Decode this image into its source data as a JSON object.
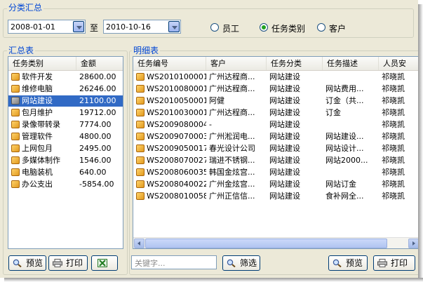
{
  "summary_group": {
    "title": "分类汇总",
    "date_from": "2008-01-01",
    "date_to_label": "至",
    "date_to": "2010-10-16",
    "radios": [
      {
        "label": "员工",
        "selected": false
      },
      {
        "label": "任务类别",
        "selected": true
      },
      {
        "label": "客户",
        "selected": false
      }
    ]
  },
  "summary_table": {
    "title": "汇总表",
    "columns": [
      "任务类别",
      "金额"
    ],
    "rows": [
      {
        "category": "软件开发",
        "amount": "28600.00",
        "selected": false
      },
      {
        "category": "维修电脑",
        "amount": "26246.00",
        "selected": false
      },
      {
        "category": "网站建设",
        "amount": "21100.00",
        "selected": true
      },
      {
        "category": "包月维护",
        "amount": "19712.00",
        "selected": false
      },
      {
        "category": "录像带转录",
        "amount": "7774.00",
        "selected": false
      },
      {
        "category": "管理软件",
        "amount": "4800.00",
        "selected": false
      },
      {
        "category": "上网包月",
        "amount": "2495.00",
        "selected": false
      },
      {
        "category": "多媒体制作",
        "amount": "1546.00",
        "selected": false
      },
      {
        "category": "电脑装机",
        "amount": "640.00",
        "selected": false
      },
      {
        "category": "办公支出",
        "amount": "-5854.00",
        "selected": false
      }
    ],
    "buttons": {
      "preview": "预览",
      "print": "打印"
    }
  },
  "detail_table": {
    "title": "明细表",
    "columns": [
      "任务编号",
      "客户",
      "任务分类",
      "任务描述",
      "人员安"
    ],
    "rows": [
      {
        "id": "WS2010100001",
        "customer": "广州达程商...",
        "category": "网站建设",
        "desc": "",
        "staff": "祁晓凯"
      },
      {
        "id": "WS2010080001",
        "customer": "广州达程商...",
        "category": "网站建设",
        "desc": "网站费用...",
        "staff": "祁晓凯"
      },
      {
        "id": "WS2010050001",
        "customer": "阿健",
        "category": "网站建设",
        "desc": "订金（共...",
        "staff": "祁晓凯"
      },
      {
        "id": "WS2010030001",
        "customer": "广州达程商...",
        "category": "网站建设",
        "desc": "订金",
        "staff": "祁晓凯"
      },
      {
        "id": "WS2009080004",
        "customer": "-",
        "category": "网站建设",
        "desc": "",
        "staff": "祁晓凯"
      },
      {
        "id": "WS2009070003",
        "customer": "广州淞润电...",
        "category": "网站建设",
        "desc": "网站建设...",
        "staff": "祁晓凯"
      },
      {
        "id": "WS2009050017",
        "customer": "春光设计公司",
        "category": "网站建设",
        "desc": "网站设计...",
        "staff": "祁晓凯"
      },
      {
        "id": "WS2008070027",
        "customer": "瑞进不锈钢...",
        "category": "网站建设",
        "desc": "网站2000...",
        "staff": "祁晓凯"
      },
      {
        "id": "WS2008060035",
        "customer": "韩国金炫宫...",
        "category": "网站建设",
        "desc": "",
        "staff": "祁晓凯"
      },
      {
        "id": "WS2008040022",
        "customer": "广州金炫宫...",
        "category": "网站建设",
        "desc": "网站订金",
        "staff": "祁晓凯"
      },
      {
        "id": "WS2008010058",
        "customer": "广州正信信...",
        "category": "网站建设",
        "desc": "食补网全...",
        "staff": "祁晓凯"
      }
    ],
    "search": {
      "placeholder": "关键字...",
      "filter_label": "筛选"
    },
    "buttons": {
      "preview": "预览",
      "print": "打印"
    }
  },
  "colors": {
    "accent": "#0046d5",
    "selection": "#316ac5",
    "window": "#ece9d8"
  }
}
